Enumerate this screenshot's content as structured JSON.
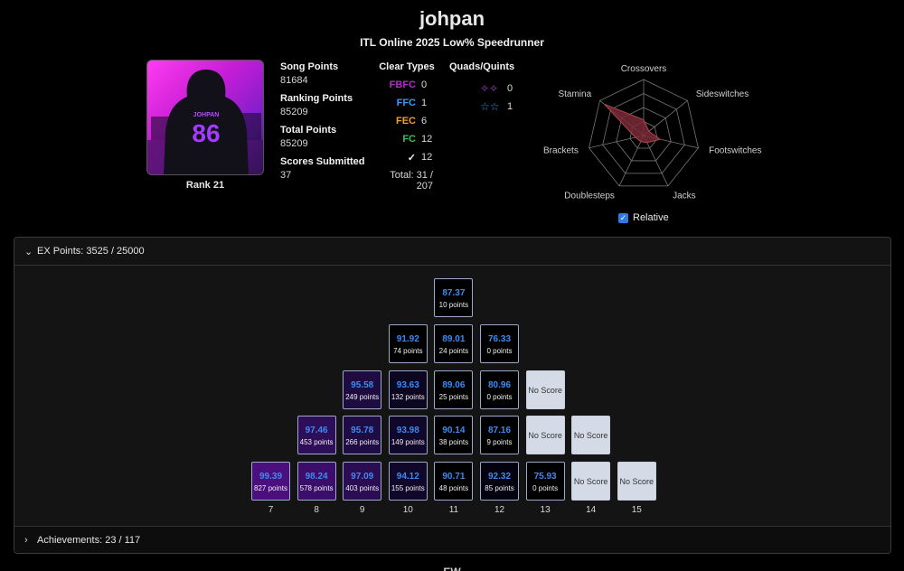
{
  "player": {
    "name": "johpan",
    "title": "ITL Online 2025 Low% Speedrunner",
    "rank_label": "Rank 21",
    "avatar_text": "JOHPAN",
    "avatar_number": "86"
  },
  "points": [
    {
      "label": "Song Points",
      "value": "81684"
    },
    {
      "label": "Ranking Points",
      "value": "85209"
    },
    {
      "label": "Total Points",
      "value": "85209"
    },
    {
      "label": "Scores Submitted",
      "value": "37"
    }
  ],
  "clear_types": {
    "header": "Clear Types",
    "rows": [
      {
        "type": "FBFC",
        "value": "0",
        "color": "#b02fc4"
      },
      {
        "type": "FFC",
        "value": "1",
        "color": "#3d9bf0"
      },
      {
        "type": "FEC",
        "value": "6",
        "color": "#f0a030"
      },
      {
        "type": "FC",
        "value": "12",
        "color": "#3fbf4f"
      },
      {
        "type": "✓",
        "value": "12",
        "color": "#f0f0f0"
      }
    ],
    "total": "Total: 31 / 207"
  },
  "quads": {
    "header": "Quads/Quints",
    "rows": [
      {
        "icon": "✧✧",
        "icon_name": "quint-star-icon",
        "value": "0"
      },
      {
        "icon": "☆☆",
        "icon_name": "quad-star-icon",
        "value": "1"
      }
    ]
  },
  "radar": {
    "axes": [
      "Crossovers",
      "Sideswitches",
      "Footswitches",
      "Jacks",
      "Doublesteps",
      "Brackets",
      "Stamina"
    ],
    "values": [
      0.28,
      0.12,
      0.3,
      0.14,
      0.12,
      0.15,
      0.9
    ],
    "fill_color": "#7a2a36"
  },
  "relative": {
    "label": "Relative",
    "checked": true
  },
  "ex_points": {
    "label": "EX Points: 3525 / 25000"
  },
  "achievements": {
    "label": "Achievements: 23 / 117"
  },
  "no_score_label": "No Score",
  "levels": [
    "7",
    "8",
    "9",
    "10",
    "11",
    "12",
    "13",
    "14",
    "15"
  ],
  "pyramid": [
    {
      "row": 0,
      "col": 4,
      "score": "87.37",
      "points": "10 points",
      "fill": "#000000"
    },
    {
      "row": 1,
      "col": 3,
      "score": "91.92",
      "points": "74 points",
      "fill": "#000000"
    },
    {
      "row": 1,
      "col": 4,
      "score": "89.01",
      "points": "24 points",
      "fill": "#000000"
    },
    {
      "row": 1,
      "col": 5,
      "score": "76.33",
      "points": "0 points",
      "fill": "#000000"
    },
    {
      "row": 2,
      "col": 2,
      "score": "95.58",
      "points": "249 points",
      "fill": "#1e0c40"
    },
    {
      "row": 2,
      "col": 3,
      "score": "93.63",
      "points": "132 points",
      "fill": "#0c0620"
    },
    {
      "row": 2,
      "col": 4,
      "score": "89.06",
      "points": "25 points",
      "fill": "#000000"
    },
    {
      "row": 2,
      "col": 5,
      "score": "80.96",
      "points": "0 points",
      "fill": "#000000"
    },
    {
      "row": 2,
      "col": 6,
      "noscore": true
    },
    {
      "row": 3,
      "col": 1,
      "score": "97.46",
      "points": "453 points",
      "fill": "#2e0e58"
    },
    {
      "row": 3,
      "col": 2,
      "score": "95.78",
      "points": "266 points",
      "fill": "#200c44"
    },
    {
      "row": 3,
      "col": 3,
      "score": "93.98",
      "points": "149 points",
      "fill": "#10072a"
    },
    {
      "row": 3,
      "col": 4,
      "score": "90.14",
      "points": "38 points",
      "fill": "#000000"
    },
    {
      "row": 3,
      "col": 5,
      "score": "87.16",
      "points": "9 points",
      "fill": "#000000"
    },
    {
      "row": 3,
      "col": 6,
      "noscore": true
    },
    {
      "row": 3,
      "col": 7,
      "noscore": true
    },
    {
      "row": 4,
      "col": 0,
      "score": "99.39",
      "points": "827 points",
      "fill": "#4c0f7e"
    },
    {
      "row": 4,
      "col": 1,
      "score": "98.24",
      "points": "578 points",
      "fill": "#3a0e6a"
    },
    {
      "row": 4,
      "col": 2,
      "score": "97.09",
      "points": "403 points",
      "fill": "#2a0d52"
    },
    {
      "row": 4,
      "col": 3,
      "score": "94.12",
      "points": "155 points",
      "fill": "#10072a"
    },
    {
      "row": 4,
      "col": 4,
      "score": "90.71",
      "points": "48 points",
      "fill": "#000000"
    },
    {
      "row": 4,
      "col": 5,
      "score": "92.32",
      "points": "85 points",
      "fill": "#050210"
    },
    {
      "row": 4,
      "col": 6,
      "score": "75.93",
      "points": "0 points",
      "fill": "#000000"
    },
    {
      "row": 4,
      "col": 7,
      "noscore": true
    },
    {
      "row": 4,
      "col": 8,
      "noscore": true
    }
  ],
  "footer_partial": "EW"
}
